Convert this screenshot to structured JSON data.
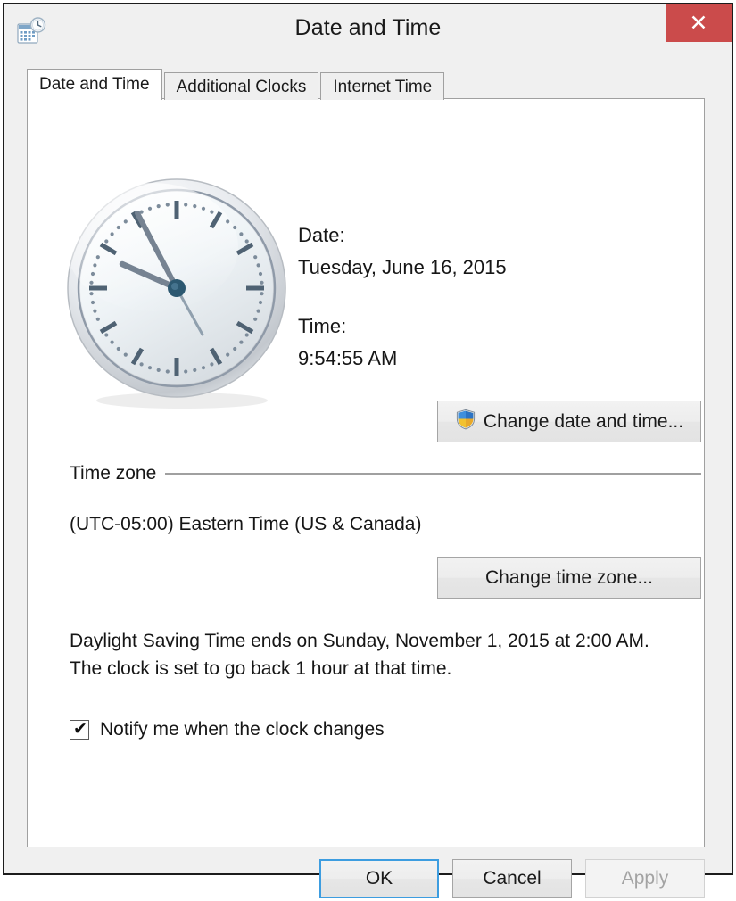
{
  "window": {
    "title": "Date and Time",
    "app_icon": "calendar-clock-icon",
    "close_label": "✕",
    "accent_close_bg": "#cb4b4b",
    "dialog_bg": "#f0f0f0",
    "panel_bg": "#ffffff"
  },
  "tabs": [
    {
      "label": "Date and Time",
      "active": true
    },
    {
      "label": "Additional Clocks",
      "active": false
    },
    {
      "label": "Internet Time",
      "active": false
    }
  ],
  "clock": {
    "icon": "analog-clock",
    "hour": 9,
    "minute": 54,
    "second": 55
  },
  "readout": {
    "date_label": "Date:",
    "date_value": "Tuesday, June 16, 2015",
    "time_label": "Time:",
    "time_value": "9:54:55 AM"
  },
  "buttons": {
    "change_datetime": "Change date and time...",
    "change_timezone": "Change time zone...",
    "shield_icon": "uac-shield-icon"
  },
  "timezone": {
    "group_label": "Time zone",
    "value": "(UTC-05:00) Eastern Time (US & Canada)"
  },
  "daylight": {
    "text": "Daylight Saving Time ends on Sunday, November 1, 2015 at 2:00 AM. The clock is set to go back 1 hour at that time.",
    "notify_label": "Notify me when the clock changes",
    "notify_checked": true,
    "check_glyph": "✔"
  },
  "footer": {
    "ok": "OK",
    "cancel": "Cancel",
    "apply": "Apply",
    "apply_disabled": true,
    "focus_color": "#3d9de0"
  }
}
